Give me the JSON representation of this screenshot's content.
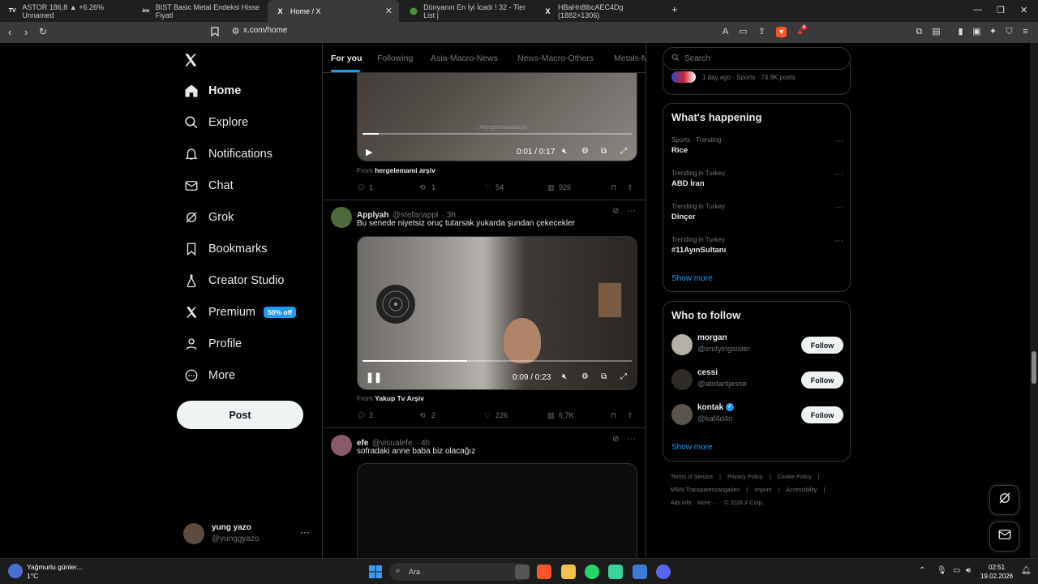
{
  "browser": {
    "tabs": [
      {
        "title": "ASTOR 186,8 ▲ +6.26% Unnamed",
        "favicon": "TV"
      },
      {
        "title": "BIST Basic Metal Endeksi Hisse Fiyatl",
        "favicon": "inv"
      },
      {
        "title": "Home / X",
        "favicon": "X"
      },
      {
        "title": "Dünyanın En İyi İcadı ! 32 - Tier List |",
        "favicon": "globe"
      },
      {
        "title": "HBaHn8lbcAEC4Dg (1882×1306)",
        "favicon": "X"
      }
    ],
    "url": "x.com/home",
    "brave_badge": "6"
  },
  "nav": {
    "items": [
      {
        "label": "Home",
        "icon": "home-icon"
      },
      {
        "label": "Explore",
        "icon": "search-icon"
      },
      {
        "label": "Notifications",
        "icon": "bell-icon"
      },
      {
        "label": "Chat",
        "icon": "mail-icon"
      },
      {
        "label": "Grok",
        "icon": "grok-icon"
      },
      {
        "label": "Bookmarks",
        "icon": "bookmark-icon"
      },
      {
        "label": "Creator Studio",
        "icon": "flask-icon"
      },
      {
        "label": "Premium",
        "icon": "x-icon"
      },
      {
        "label": "Profile",
        "icon": "person-icon"
      },
      {
        "label": "More",
        "icon": "more-circle-icon"
      }
    ],
    "premium_badge": "50% off",
    "post_label": "Post",
    "account": {
      "name": "yung yazo",
      "handle": "@yunggyazo"
    }
  },
  "feed": {
    "tabs": [
      "For you",
      "Following",
      "Asia-Macro-News",
      "News-Macro-Others",
      "Metals-M"
    ],
    "post1": {
      "time": "0:01 / 0:17",
      "progress": 0.06,
      "from_label": "From",
      "from_name": "hergelemami arşiv",
      "watermark": "#hergelemamiarşiv",
      "replies": "1",
      "reposts": "1",
      "likes": "54",
      "views": "926"
    },
    "post2": {
      "name": "Applyah",
      "handle": "@stefanappl",
      "time": "· 3h",
      "text": "Bu senede niyetsiz oruç tutarsak yukarda şundan çekecekler",
      "video_time": "0:09 / 0:23",
      "progress": 0.39,
      "from_label": "From",
      "from_name": "Yakup Tv Arşiv",
      "replies": "2",
      "reposts": "2",
      "likes": "226",
      "views": "6,7K"
    },
    "post3": {
      "name": "efe",
      "handle": "@visualefe",
      "time": "· 4h",
      "text": "sofradaki anne baba biz olacağız"
    }
  },
  "sidebar": {
    "search_placeholder": "Search",
    "top_meta": "1 day ago · Sports · 74,9K posts",
    "happening_title": "What's happening",
    "trends": [
      {
        "meta": "Sports · Trending",
        "title": "Rice"
      },
      {
        "meta": "Trending in Turkey",
        "title": "ABD İran"
      },
      {
        "meta": "Trending in Turkey",
        "title": "Dinçer"
      },
      {
        "meta": "Trending in Turkey",
        "title": "#11AyınSultanı"
      }
    ],
    "show_more": "Show more",
    "who_title": "Who to follow",
    "who": [
      {
        "name": "morgan",
        "handle": "@imdyingsister",
        "verified": false
      },
      {
        "name": "cessi",
        "handle": "@abdartijesse",
        "verified": false
      },
      {
        "name": "kontak",
        "handle": "@kaf4d4n",
        "verified": true
      }
    ],
    "follow_label": "Follow",
    "footer": [
      "Terms of Service",
      "|",
      "Privacy Policy",
      "|",
      "Cookie Policy",
      "|",
      "MStV Transparenzangaben",
      "|",
      "Imprint",
      "|",
      "Accessibility",
      "|",
      "Ads info",
      "More ···",
      "© 2026 X Corp."
    ]
  },
  "taskbar": {
    "weather_line1": "Yağmurlu günler...",
    "weather_line2": "1°C",
    "search": "Ara",
    "time": "02:51",
    "date": "19.02.2026"
  },
  "colors": {
    "accent": "#1d9bf0",
    "bg": "#000000",
    "border": "#2f3336",
    "muted": "#71767b"
  }
}
